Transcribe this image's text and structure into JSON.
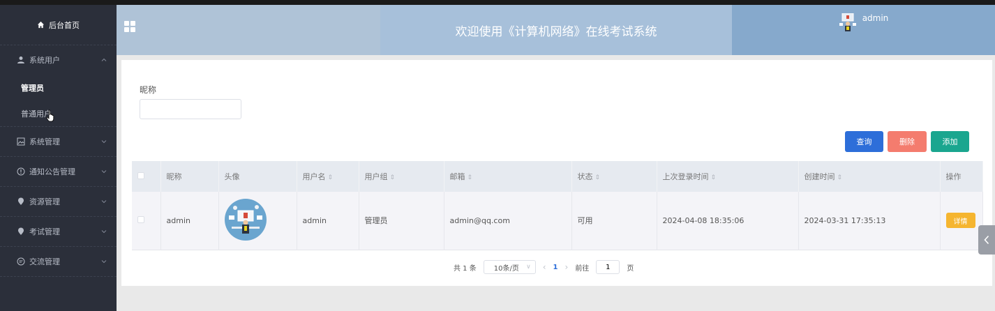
{
  "sidebar": {
    "home_label": "后台首页",
    "groups": [
      {
        "label": "系统用户",
        "icon": "user-icon",
        "expanded": true,
        "items": [
          {
            "label": "管理员",
            "active": true
          },
          {
            "label": "普通用户",
            "active": false
          }
        ]
      },
      {
        "label": "系统管理",
        "icon": "image-icon",
        "expanded": false
      },
      {
        "label": "通知公告管理",
        "icon": "info-icon",
        "expanded": false
      },
      {
        "label": "资源管理",
        "icon": "location-pin-icon",
        "expanded": false
      },
      {
        "label": "考试管理",
        "icon": "location-pin-icon",
        "expanded": false
      },
      {
        "label": "交流管理",
        "icon": "chat-icon",
        "expanded": false
      }
    ]
  },
  "header": {
    "title": "欢迎使用《计算机网络》在线考试系统",
    "username": "admin"
  },
  "filter": {
    "label": "昵称",
    "value": "",
    "placeholder": ""
  },
  "buttons": {
    "query": "查询",
    "delete": "删除",
    "add": "添加"
  },
  "table": {
    "columns": [
      "昵称",
      "头像",
      "用户名",
      "用户组",
      "邮箱",
      "状态",
      "上次登录时间",
      "创建时间",
      "操作"
    ],
    "rows": [
      {
        "nickname": "admin",
        "username": "admin",
        "group": "管理员",
        "email": "admin@qq.com",
        "status": "可用",
        "last_login": "2024-04-08 18:35:06",
        "created": "2024-03-31 17:35:13",
        "action": "详情"
      }
    ]
  },
  "pagination": {
    "total": "共 1 条",
    "page_size": "10条/页",
    "current_page": "1",
    "goto_label": "前往",
    "goto_value": "1",
    "page_suffix": "页"
  },
  "colors": {
    "sidebar_bg": "#2b2f3a",
    "query": "#2d6ed9",
    "delete": "#f47c6e",
    "add": "#1aa68f",
    "detail": "#f5b530"
  }
}
